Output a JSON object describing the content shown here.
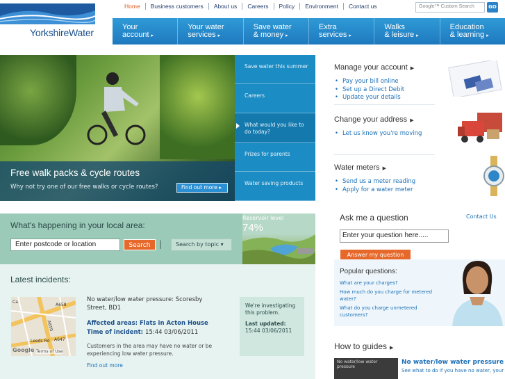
{
  "brand": {
    "name": "YorkshireWater",
    "accent": "#1e79bf",
    "orange": "#e6682a"
  },
  "topnav": [
    "Home",
    "Business customers",
    "About us",
    "Careers",
    "Policy",
    "Environment",
    "Contact us"
  ],
  "search": {
    "placeholder": "Custom Search",
    "provider": "Google™",
    "go_label": "GO"
  },
  "mainnav": [
    {
      "line1": "Your",
      "line2": "account"
    },
    {
      "line1": "Your water",
      "line2": "services"
    },
    {
      "line1": "Save water",
      "line2": "& money"
    },
    {
      "line1": "Extra",
      "line2": "services"
    },
    {
      "line1": "Walks",
      "line2": "& leisure"
    },
    {
      "line1": "Education",
      "line2": "& learning"
    }
  ],
  "hero": {
    "title": "Free walk packs & cycle routes",
    "subtitle": "Why not try one of our free walks or cycle routes?",
    "cta": "Find out more"
  },
  "hero_side": [
    "Save water this summer",
    "Careers",
    "What would you like to do today?",
    "Prizes for parents",
    "Water saving products"
  ],
  "local": {
    "title": "What's happening in your local area:",
    "postcode_value": "Enter postcode or location",
    "search_label": "Search",
    "separator": "|",
    "by_topic": "Search by topic",
    "reservoir_label": "Reservoir level",
    "reservoir_value": "74%",
    "reservoir_fraction": 0.74
  },
  "incidents": {
    "title": "Latest incidents:",
    "map_labels": [
      "A658",
      "A650",
      "A647",
      "Leeds Rd",
      "Ca",
      "Google",
      "Terms of Use"
    ],
    "heading": "No water/low water pressure: Scoresby Street, BD1",
    "area_label": "Affected areas:",
    "area_value": "Flats in Acton House",
    "time_label": "Time of incident:",
    "time_value": "15:44 03/06/2011",
    "description": "Customers in the area may have no water or be experiencing low water pressure.",
    "link": "Find out more",
    "status": "We're investigating this problem.",
    "updated_label": "Last updated:",
    "updated_value": "15:44 03/06/2011"
  },
  "account": {
    "title": "Manage your account",
    "links": [
      "Pay your bill online",
      "Set up a Direct Debit",
      "Update your details"
    ]
  },
  "address": {
    "title": "Change your address",
    "links": [
      "Let us know you're moving"
    ]
  },
  "meters": {
    "title": "Water meters",
    "links": [
      "Send us a meter reading",
      "Apply for a water meter"
    ]
  },
  "ask": {
    "title": "Ask me a question",
    "contact": "Contact Us",
    "input_value": "Enter your question here.....",
    "button": "Answer my question",
    "popular_title": "Popular questions:",
    "questions": [
      "What are your charges?",
      "How much do you charge for metered water?",
      "What do you charge unmetered customers?"
    ]
  },
  "howto": {
    "title": "How to guides",
    "image_caption": "No water/low water pressure",
    "guide_title": "No water/low water pressure",
    "guide_sub": "See what to do if you have no water, your water pressure is low or you can't"
  },
  "icons": [
    "arrow-right-icon",
    "bullet-icon",
    "chevron-down-icon"
  ]
}
